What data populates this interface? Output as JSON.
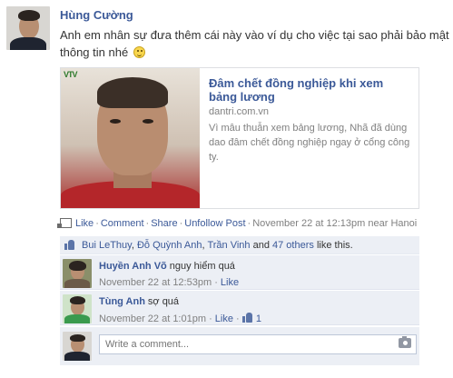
{
  "post": {
    "author": "Hùng Cường",
    "message": "Anh em nhân sự đưa thêm cái này vào ví dụ cho việc tại sao phải bảo mật thông tin nhé",
    "emoticon_icon": "smiley-icon"
  },
  "shared_link": {
    "photo_logo": "VTV",
    "title": "Đâm chết đồng nghiệp khi xem bảng lương",
    "domain": "dantri.com.vn",
    "description": "Vì mâu thuẫn xem bảng lương, Nhã đã dùng dao đâm chết đồng nghiệp ngay ở cổng công ty."
  },
  "actions": {
    "like": "Like",
    "comment": "Comment",
    "share": "Share",
    "unfollow": "Unfollow Post",
    "timestamp": "November 22 at 12:13pm near Hanoi"
  },
  "likes": {
    "names": [
      "Bui LeThuy",
      "Đỗ Quỳnh Anh",
      "Trần Vinh"
    ],
    "others": "47 others",
    "suffix": "like this.",
    "and": "and"
  },
  "comments": [
    {
      "name": "Huyền Anh Võ",
      "text": "nguy hiểm quá",
      "time": "November 22 at 12:53pm",
      "like": "Like",
      "like_count": ""
    },
    {
      "name": "Tùng Anh",
      "text": "sợ quá",
      "time": "November 22 at 1:01pm",
      "like": "Like",
      "like_count": "1"
    }
  ],
  "composer": {
    "placeholder": "Write a comment..."
  },
  "colors": {
    "link": "#3b5998",
    "ufi_bg": "#eceff5",
    "meta": "#808080"
  }
}
